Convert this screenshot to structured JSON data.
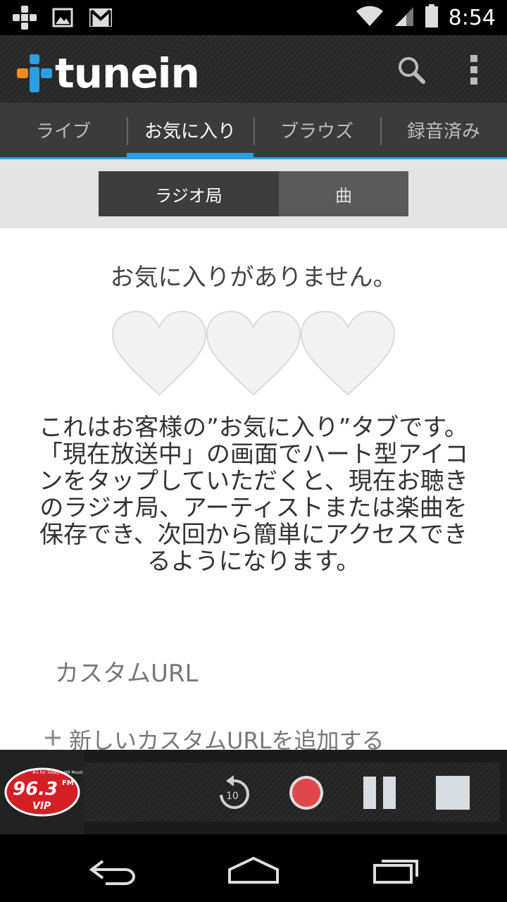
{
  "status_bar": {
    "time": "8:54",
    "left_icons": [
      "cross-notification-icon",
      "image-icon",
      "gmail-icon"
    ],
    "right_icons": [
      "wifi-icon",
      "signal-icon",
      "battery-icon"
    ]
  },
  "app_bar": {
    "logo_text": "tunein",
    "actions": [
      "search-icon",
      "overflow-menu-icon"
    ]
  },
  "tabs": [
    {
      "label": "ライブ",
      "active": false
    },
    {
      "label": "お気に入り",
      "active": true
    },
    {
      "label": "ブラウズ",
      "active": false
    },
    {
      "label": "録音済み",
      "active": false
    }
  ],
  "segment": {
    "stations": "ラジオ局",
    "songs": "曲",
    "selected": "ラジオ局"
  },
  "empty_state": {
    "title": "お気に入りがありません。",
    "description": "これはお客様の”お気に入り”タブです。「現在放送中」の画面でハート型アイコンをタップしていただくと、現在お聴きのラジオ局、アーティストまたは楽曲を保存でき、次回から簡単にアクセスできるようになります。"
  },
  "custom_url": {
    "label": "カスタムURL",
    "add_label": "新しいカスタムURLを追加する"
  },
  "player": {
    "station_logo_text": "96.3",
    "station_logo_sub": "VIP",
    "station_logo_fm": "FM",
    "station_logo_tag": "#1 for Today's Hit Music",
    "rewind_seconds": "10",
    "colors": {
      "record": "#e0474a",
      "accent": "#2aa0e0"
    }
  },
  "nav_bar": {
    "buttons": [
      "back-icon",
      "home-icon",
      "recents-icon"
    ]
  }
}
